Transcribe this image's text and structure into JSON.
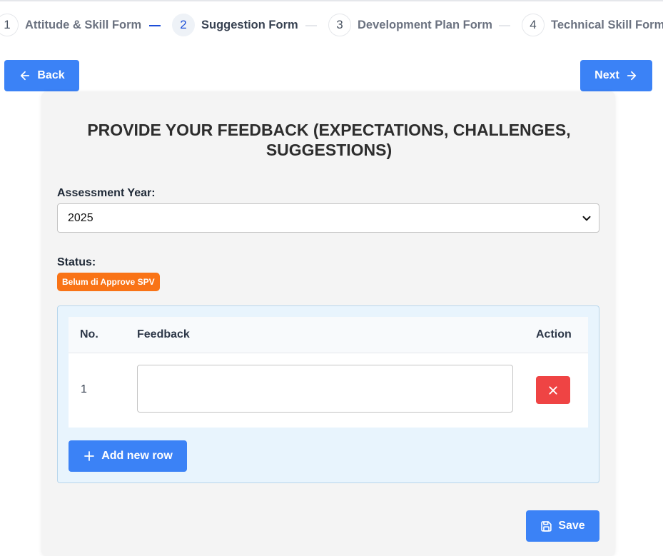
{
  "stepper": {
    "steps": [
      {
        "number": "1",
        "label": "Attitude & Skill Form"
      },
      {
        "number": "2",
        "label": "Suggestion Form"
      },
      {
        "number": "3",
        "label": "Development Plan Form"
      },
      {
        "number": "4",
        "label": "Technical Skill Form"
      }
    ],
    "active_step": 2
  },
  "nav": {
    "back_label": "Back",
    "next_label": "Next"
  },
  "form": {
    "title": "PROVIDE YOUR FEEDBACK (EXPECTATIONS, CHALLENGES, SUGGESTIONS)",
    "year_label": "Assessment Year:",
    "year_value": "2025",
    "status_label": "Status:",
    "status_badge": "Belum di Approve SPV"
  },
  "table": {
    "columns": [
      "No.",
      "Feedback",
      "Action"
    ],
    "rows": [
      {
        "no": "1",
        "feedback": ""
      }
    ],
    "add_row_label": "Add new row"
  },
  "save_label": "Save",
  "colors": {
    "primary": "#3b82f6",
    "danger": "#ef4444",
    "status_badge": "#f97316",
    "active_step": "#1d4ed8"
  },
  "icons": {
    "back": "arrow-left-icon",
    "next": "arrow-right-icon",
    "select": "chevron-down-icon",
    "delete": "close-icon",
    "add": "plus-icon",
    "save": "save-icon"
  }
}
